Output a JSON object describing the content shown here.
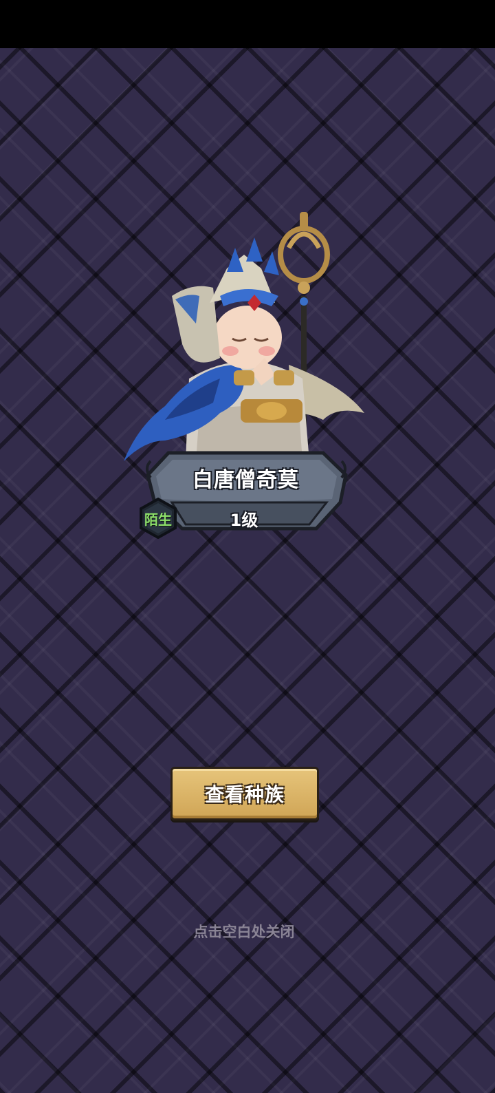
{
  "hero": {
    "name": "白唐僧奇莫",
    "level": "1级",
    "status": "陌生",
    "icon": "monk-hero-portrait"
  },
  "actions": {
    "view_race_label": "查看种族"
  },
  "hint": {
    "close_text": "点击空白处关闭"
  },
  "colors": {
    "background": "#332c4b",
    "button": "#d8b062",
    "status_green": "#8ee06a",
    "plate": "#505a6a"
  }
}
